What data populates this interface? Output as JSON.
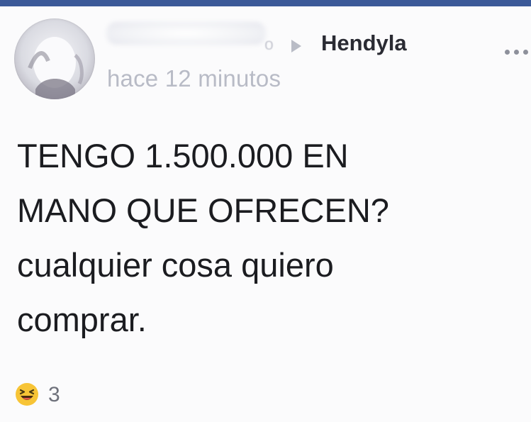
{
  "header": {
    "group_name": "Hendyla",
    "name_fragment": "o",
    "timestamp": "hace 12 minutos"
  },
  "post": {
    "lines": [
      "TENGO 1.500.000 EN",
      "MANO QUE OFRECEN?",
      "cualquier cosa quiero",
      "comprar."
    ]
  },
  "reactions": {
    "icon": "haha-emoji-icon",
    "count": "3"
  },
  "colors": {
    "top_bar": "#3b5998",
    "text": "#1b1c20",
    "muted": "#b8bbc6"
  }
}
